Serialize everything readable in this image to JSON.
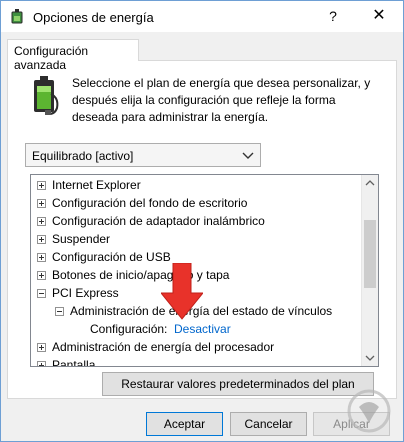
{
  "window": {
    "title": "Opciones de energía",
    "help_label": "?",
    "close_label": "✕"
  },
  "tab": {
    "label": "Configuración avanzada"
  },
  "intro": {
    "lines": [
      "Seleccione el plan de energía que desea personalizar, y",
      "después elija la configuración que refleje la forma",
      "deseada para administrar la energía."
    ]
  },
  "plan_select": {
    "value": "Equilibrado [activo]"
  },
  "tree": {
    "items": [
      {
        "label": "Internet Explorer",
        "expanded": false
      },
      {
        "label": "Configuración del fondo de escritorio",
        "expanded": false
      },
      {
        "label": "Configuración de adaptador inalámbrico",
        "expanded": false
      },
      {
        "label": "Suspender",
        "expanded": false
      },
      {
        "label": "Configuración de USB",
        "expanded": false
      },
      {
        "label": "Botones de inicio/apagado y tapa",
        "expanded": false
      },
      {
        "label": "PCI Express",
        "expanded": true
      },
      {
        "label": "Administración de energía del estado de vínculos",
        "expanded": true
      },
      {
        "label": "Configuración:",
        "value": "Desactivar"
      },
      {
        "label": "Administración de energía del procesador",
        "expanded": false
      },
      {
        "label": "Pantalla",
        "expanded": false
      }
    ]
  },
  "buttons": {
    "restore": "Restaurar valores predeterminados del plan",
    "accept": "Aceptar",
    "cancel": "Cancelar",
    "apply": "Aplicar"
  },
  "colors": {
    "link": "#0066cc",
    "arrow": "#e8322a",
    "accent_border": "#0078d7"
  },
  "icons": {
    "app": "power-options-icon",
    "battery": "battery-plug-icon",
    "pointer": "red-arrow-icon",
    "watermark": "logo-watermark-icon"
  }
}
